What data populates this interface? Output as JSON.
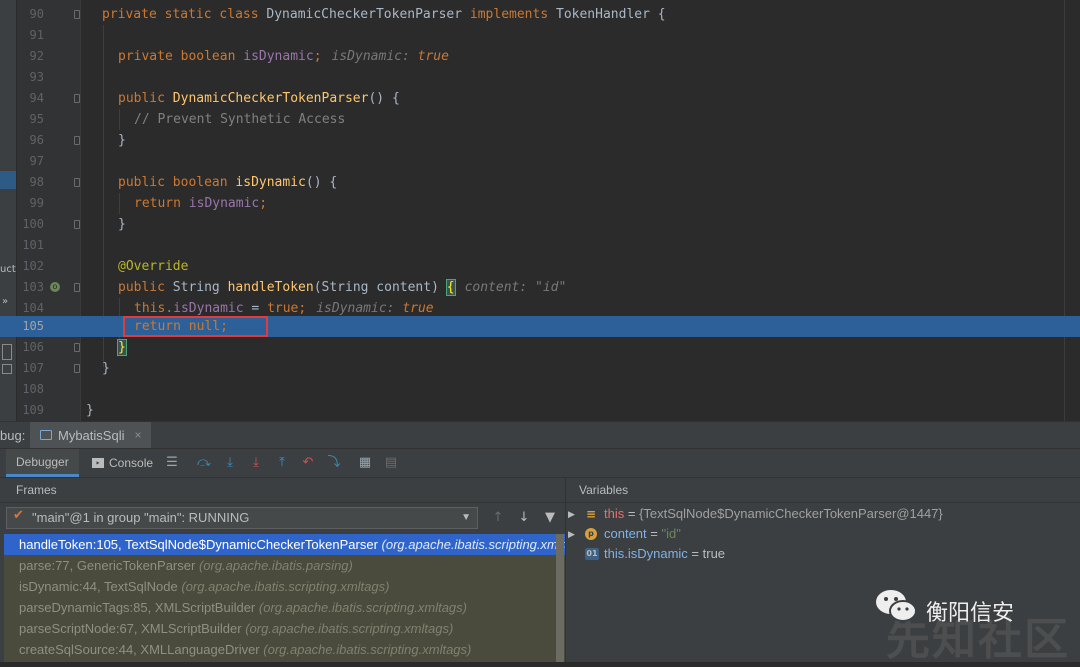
{
  "editor": {
    "lines": [
      {
        "n": "90"
      },
      {
        "n": "91"
      },
      {
        "n": "92"
      },
      {
        "n": "93"
      },
      {
        "n": "94"
      },
      {
        "n": "95"
      },
      {
        "n": "96"
      },
      {
        "n": "97"
      },
      {
        "n": "98"
      },
      {
        "n": "99"
      },
      {
        "n": "100"
      },
      {
        "n": "101"
      },
      {
        "n": "102"
      },
      {
        "n": "103"
      },
      {
        "n": "104"
      },
      {
        "n": "105"
      },
      {
        "n": "106"
      },
      {
        "n": "107"
      },
      {
        "n": "108"
      },
      {
        "n": "109"
      }
    ],
    "current_line": "105",
    "side_label": "uct",
    "side_chevron": "»",
    "tok": {
      "private": "private",
      "static": "static",
      "class": "class",
      "class_name": "DynamicCheckerTokenParser",
      "implements": "implements",
      "iface": "TokenHandler",
      "open_brace": "{",
      "close_brace": "}",
      "boolean": "boolean",
      "isDynamic_field": "isDynamic",
      "semicolon": ";",
      "hint_isDynamic_label": "isDynamic:",
      "true": "true",
      "public": "public",
      "ctor_name": "DynamicCheckerTokenParser",
      "parens_brace": "() {",
      "comment": "// Prevent Synthetic Access",
      "isDynamic_method": "isDynamic",
      "return": "return",
      "annotation": "@Override",
      "String": "String",
      "handleToken": "handleToken",
      "param": "(String content)",
      "hint_content_label": "content:",
      "hint_content_value": "\"id\"",
      "this": "this",
      "dot_isDynamic": ".isDynamic",
      "assign": " = ",
      "null": "null"
    }
  },
  "debug": {
    "label": "bug:",
    "session_tab": "MybatisSqli",
    "session_close": "×",
    "tabs": {
      "debugger": "Debugger",
      "console": "Console"
    },
    "frames_header": "Frames",
    "variables_header": "Variables",
    "thread": {
      "check": "✔",
      "text": "\"main\"@1 in group \"main\": RUNNING",
      "dropdown": "▼"
    },
    "frames": [
      {
        "method": "handleToken:105, TextSqlNode$DynamicCheckerTokenParser",
        "pkg": "(org.apache.ibatis.scripting.xmltags)"
      },
      {
        "method": "parse:77, GenericTokenParser",
        "pkg": "(org.apache.ibatis.parsing)"
      },
      {
        "method": "isDynamic:44, TextSqlNode",
        "pkg": "(org.apache.ibatis.scripting.xmltags)"
      },
      {
        "method": "parseDynamicTags:85, XMLScriptBuilder",
        "pkg": "(org.apache.ibatis.scripting.xmltags)"
      },
      {
        "method": "parseScriptNode:67, XMLScriptBuilder",
        "pkg": "(org.apache.ibatis.scripting.xmltags)"
      },
      {
        "method": "createSqlSource:44, XMLLanguageDriver",
        "pkg": "(org.apache.ibatis.scripting.xmltags)"
      }
    ],
    "variables": [
      {
        "expander": "▶",
        "icon": "≡",
        "name": "this",
        "eq": " = ",
        "value": "{TextSqlNode$DynamicCheckerTokenParser@1447}"
      },
      {
        "expander": "▶",
        "icon": "p",
        "name": "content",
        "eq": " = ",
        "value": "\"id\""
      },
      {
        "expander": "",
        "icon": "01",
        "name": "this.isDynamic",
        "eq": " = ",
        "value": "true"
      }
    ],
    "colors": {
      "selection": "#2f65ca",
      "current_line": "#2d6099",
      "keyword": "#cc7832",
      "method": "#ffc66d",
      "field": "#9876aa"
    }
  },
  "watermark": {
    "text": "衡阳信安",
    "faint": "先知社区"
  }
}
